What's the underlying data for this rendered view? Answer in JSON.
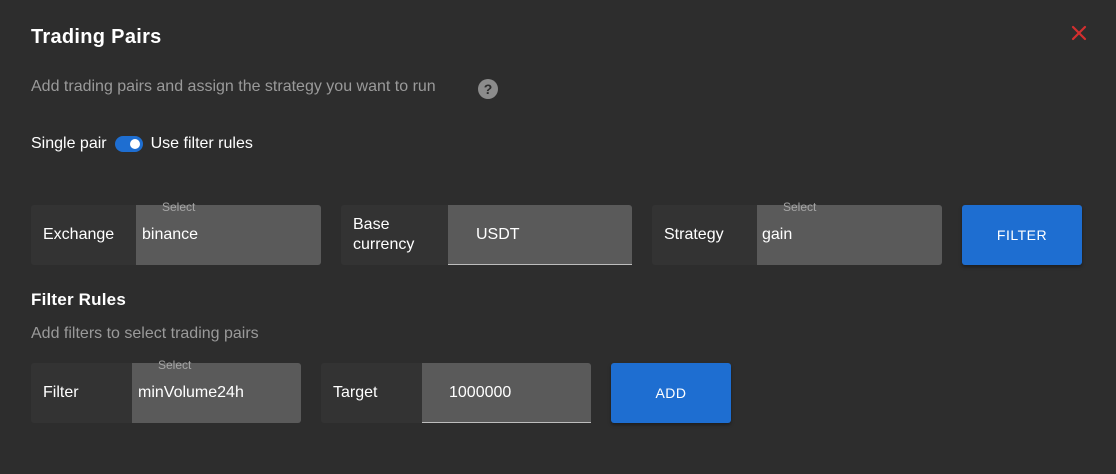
{
  "dialog": {
    "title": "Trading Pairs",
    "subtitle": "Add trading pairs and assign the strategy you want to run",
    "help_glyph": "?",
    "close_icon": "close-icon",
    "close_color": "#d32f2f"
  },
  "mode": {
    "left_label": "Single pair",
    "right_label": "Use filter rules",
    "toggle_on": true,
    "toggle_color": "#1e6ed1"
  },
  "pair_form": {
    "exchange": {
      "label": "Exchange",
      "hint": "Select",
      "value": "binance"
    },
    "base_currency": {
      "label": "Base currency",
      "value": "USDT"
    },
    "strategy": {
      "label": "Strategy",
      "hint": "Select",
      "value": "gain"
    },
    "filter_button": "FILTER"
  },
  "filter_rules": {
    "title": "Filter Rules",
    "subtitle": "Add filters to select trading pairs",
    "filter": {
      "label": "Filter",
      "hint": "Select",
      "value": "minVolume24h"
    },
    "target": {
      "label": "Target",
      "value": "1000000"
    },
    "add_button": "ADD"
  }
}
